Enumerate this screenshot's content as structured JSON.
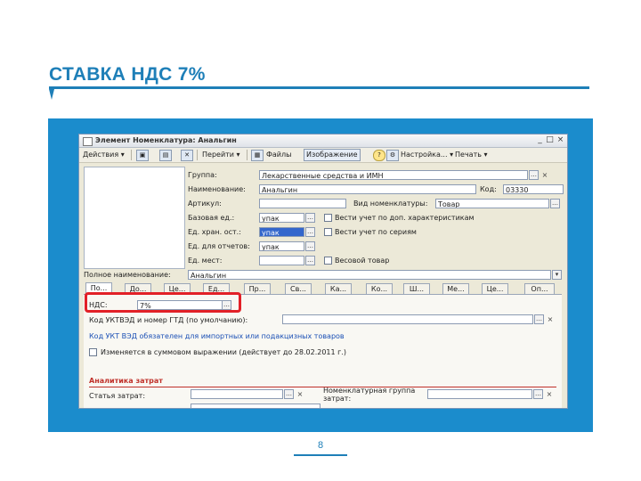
{
  "slide": {
    "title": "СТАВКА НДС 7%",
    "page_number": "8"
  },
  "window": {
    "title": "Элемент Номенклатура: Анальгин",
    "controls": [
      "_",
      "□",
      "×"
    ]
  },
  "toolbar": {
    "actions": "Действия",
    "goto": "Перейти",
    "files": "Файлы",
    "images": "Изображение",
    "help": "?",
    "settings": "Настройка...",
    "print": "Печать"
  },
  "form": {
    "group_label": "Группа:",
    "group_value": "Лекарственные средства и ИМН",
    "name_label": "Наименование:",
    "name_value": "Анальгин",
    "code_label": "Код:",
    "code_value": "03330",
    "article_label": "Артикул:",
    "article_value": "",
    "kind_label": "Вид номенклатуры:",
    "kind_value": "Товар",
    "base_unit_label": "Базовая ед.:",
    "base_unit_value": "упак",
    "storage_unit_label": "Ед. хран. ост.:",
    "storage_unit_value": "упак",
    "report_unit_label": "Ед. для отчетов:",
    "report_unit_value": "упак",
    "place_unit_label": "Ед. мест:",
    "place_unit_value": "",
    "chk_characteristics": "Вести учет по доп. характеристикам",
    "chk_series": "Вести учет по сериям",
    "chk_weight": "Весовой товар",
    "fullname_label": "Полное наименование:",
    "fullname_value": "Анальгин"
  },
  "tabs": [
    "По...",
    "До...",
    "Це...",
    "Ед...",
    "Пр...",
    "Св...",
    "Ка...",
    "Ко...",
    "Ш...",
    "Ме...",
    "Це...",
    "Оп..."
  ],
  "pane": {
    "vat_label": "НДС:",
    "vat_value": "7%",
    "tnved_label": "Код УКТВЭД и номер ГТД (по умолчанию):",
    "tnved_value": "",
    "tnved_link": "Код УКТ ВЭД обязателен для импортных или подакцизных товаров",
    "chk_sum_expr": "Изменяется в суммовом выражении (действует до 28.02.2011 г.)",
    "section_costs": "Аналитика затрат",
    "cost_item_label": "Статья затрат:",
    "cost_item_value": "",
    "nom_group_label": "Номенклатурная группа затрат:",
    "nom_group_value": ""
  },
  "colors": {
    "accent": "#1e7fb8",
    "frame": "#1b8ccc",
    "highlight": "#e22027"
  }
}
